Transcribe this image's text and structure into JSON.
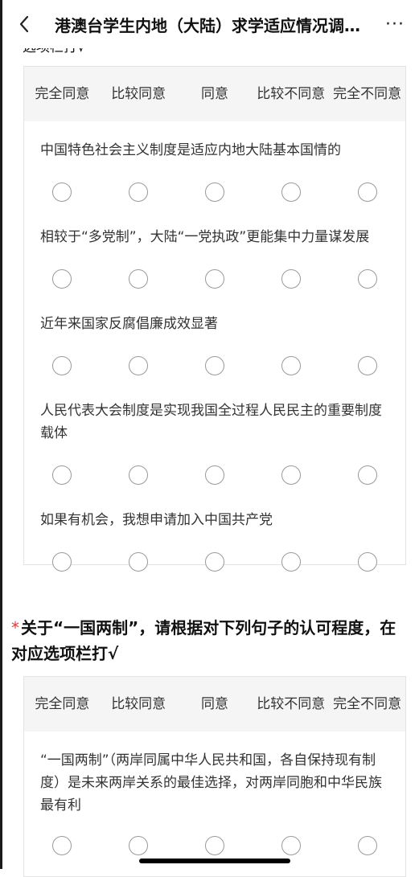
{
  "nav": {
    "title": "港澳台学生内地（大陆）求学适应情况调查问卷",
    "more": "···"
  },
  "partial_text": "选项栏打√",
  "options": [
    "完全同意",
    "比较同意",
    "同意",
    "比较不同意",
    "完全不同意"
  ],
  "matrix1": [
    "中国特色社会主义制度是适应内地大陆基本国情的",
    "相较于“多党制”，大陆“一党执政”更能集中力量谋发展",
    "近年来国家反腐倡廉成效显著",
    "人民代表大会制度是实现我国全过程人民民主的重要制度载体",
    "如果有机会，我想申请加入中国共产党"
  ],
  "question2": {
    "required_mark": "*",
    "text": "关于“一国两制”，请根据对下列句子的认可程度，在对应选项栏打√"
  },
  "matrix2": [
    "“一国两制”（两岸同属中华人民共和国，各自保持现有制度）是未来两岸关系的最佳选择，对两岸同胞和中华民族最有利"
  ]
}
